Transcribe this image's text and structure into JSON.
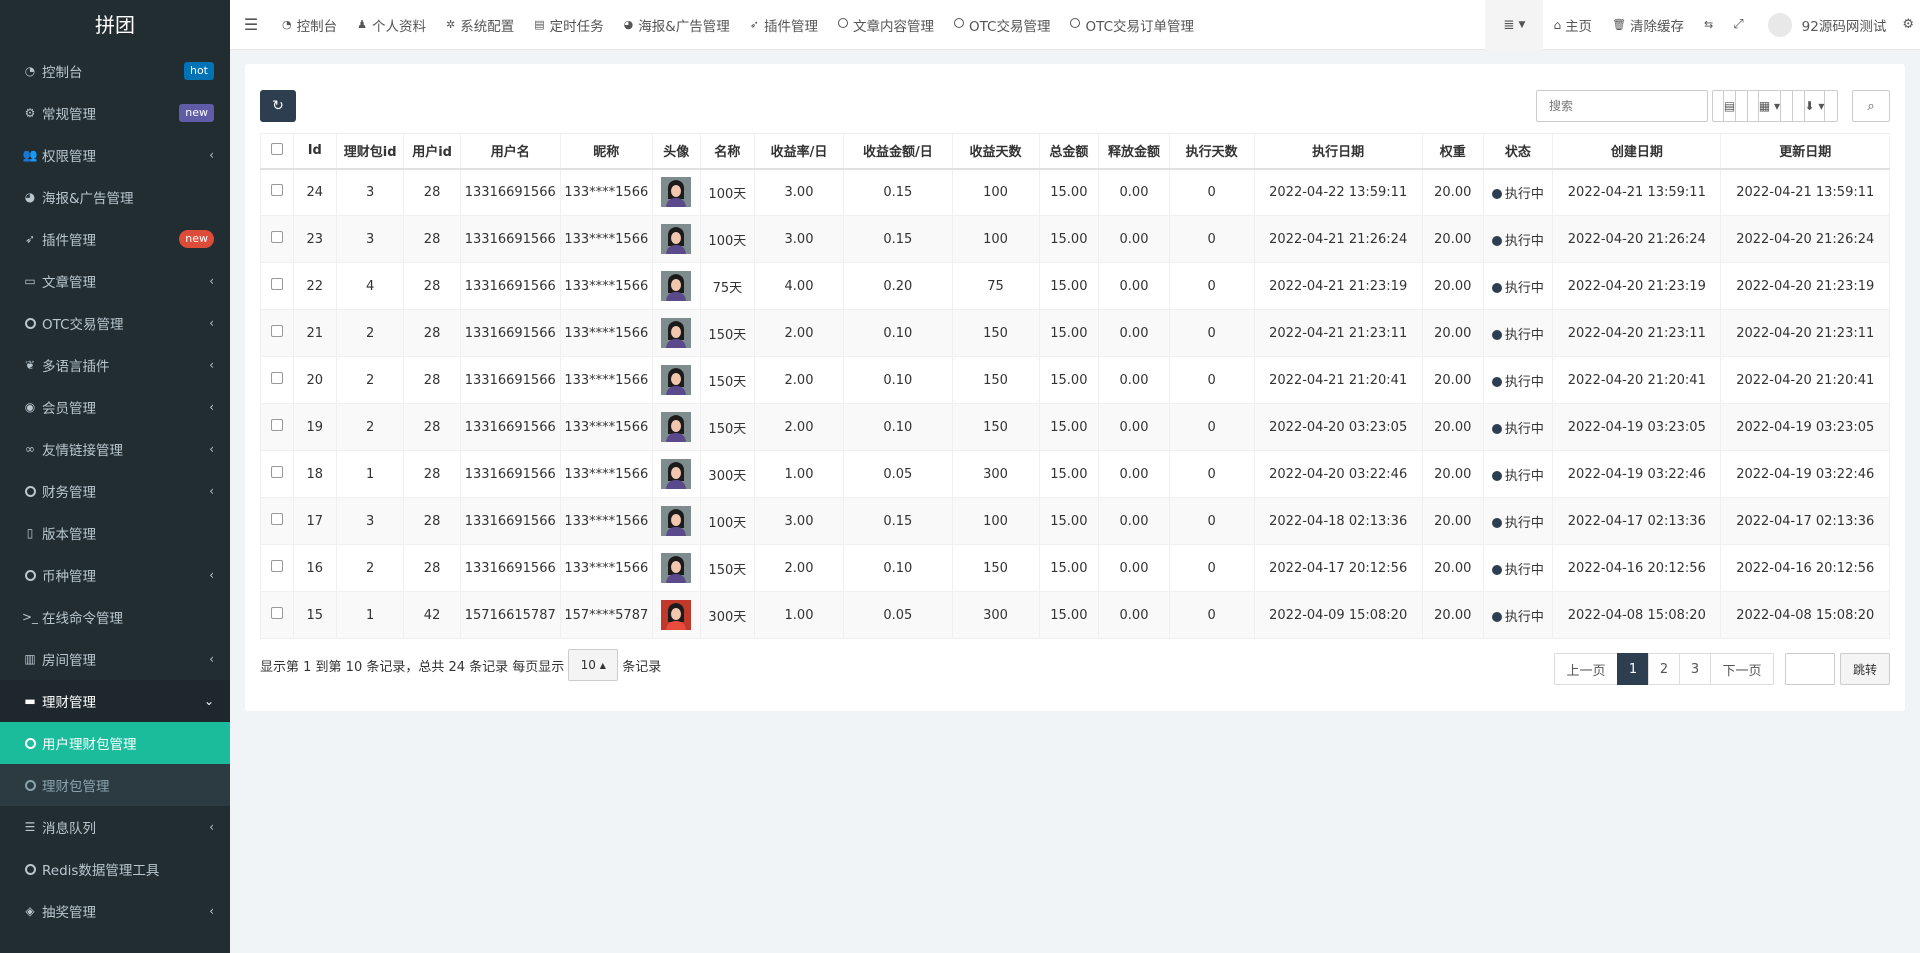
{
  "brand": "拼团",
  "sidebar": {
    "items": [
      {
        "label": "控制台",
        "icon": "dashboard-icon",
        "badge": "hot"
      },
      {
        "label": "常规管理",
        "icon": "cogs-icon",
        "badge": "new"
      },
      {
        "label": "权限管理",
        "icon": "group-icon",
        "arrow": "‹"
      },
      {
        "label": "海报&广告管理",
        "icon": "palette-icon"
      },
      {
        "label": "插件管理",
        "icon": "rocket-icon",
        "badge": "new"
      },
      {
        "label": "文章管理",
        "icon": "folder-icon",
        "arrow": "‹"
      },
      {
        "label": "OTC交易管理",
        "icon": "circle-icon",
        "arrow": "‹"
      },
      {
        "label": "多语言插件",
        "icon": "leaf-icon",
        "arrow": "‹"
      },
      {
        "label": "会员管理",
        "icon": "user-circle-icon",
        "arrow": "‹"
      },
      {
        "label": "友情链接管理",
        "icon": "link-icon",
        "arrow": "‹"
      },
      {
        "label": "财务管理",
        "icon": "circle-icon",
        "arrow": "‹"
      },
      {
        "label": "版本管理",
        "icon": "file-icon"
      },
      {
        "label": "币种管理",
        "icon": "circle-icon",
        "arrow": "‹"
      },
      {
        "label": "在线命令管理",
        "icon": "terminal-icon"
      },
      {
        "label": "房间管理",
        "icon": "bar-chart-icon",
        "arrow": "‹"
      },
      {
        "label": "理财管理",
        "icon": "visa-icon",
        "arrow": "⌄"
      },
      {
        "label": "用户理财包管理",
        "icon": "circle-icon"
      },
      {
        "label": "理财包管理",
        "icon": "circle-icon"
      },
      {
        "label": "消息队列",
        "icon": "list-icon",
        "arrow": "‹"
      },
      {
        "label": "Redis数据管理工具",
        "icon": "circle-icon"
      },
      {
        "label": "抽奖管理",
        "icon": "cube-icon",
        "arrow": "‹"
      }
    ]
  },
  "header": {
    "nav": [
      {
        "label": "控制台",
        "icon": "dashboard-icon"
      },
      {
        "label": "个人资料",
        "icon": "user-icon"
      },
      {
        "label": "系统配置",
        "icon": "gear-icon"
      },
      {
        "label": "定时任务",
        "icon": "tasks-icon"
      },
      {
        "label": "海报&广告管理",
        "icon": "palette-icon"
      },
      {
        "label": "插件管理",
        "icon": "rocket-icon"
      },
      {
        "label": "文章内容管理",
        "icon": "circle-icon"
      },
      {
        "label": "OTC交易管理",
        "icon": "circle-icon"
      },
      {
        "label": "OTC交易订单管理",
        "icon": "circle-icon"
      }
    ],
    "home": "主页",
    "clear_cache": "清除缓存",
    "user": "92源码网测试"
  },
  "toolbar": {
    "search_placeholder": "搜索"
  },
  "table": {
    "columns": [
      "Id",
      "理财包id",
      "用户id",
      "用户名",
      "昵称",
      "头像",
      "名称",
      "收益率/日",
      "收益金额/日",
      "收益天数",
      "总金额",
      "释放金额",
      "执行天数",
      "执行日期",
      "权重",
      "状态",
      "创建日期",
      "更新日期"
    ],
    "rows": [
      [
        "24",
        "3",
        "28",
        "13316691566",
        "133****1566",
        "",
        "100天",
        "3.00",
        "0.15",
        "100",
        "15.00",
        "0.00",
        "0",
        "2022-04-22 13:59:11",
        "20.00",
        "执行中",
        "2022-04-21 13:59:11",
        "2022-04-21 13:59:11"
      ],
      [
        "23",
        "3",
        "28",
        "13316691566",
        "133****1566",
        "",
        "100天",
        "3.00",
        "0.15",
        "100",
        "15.00",
        "0.00",
        "0",
        "2022-04-21 21:26:24",
        "20.00",
        "执行中",
        "2022-04-20 21:26:24",
        "2022-04-20 21:26:24"
      ],
      [
        "22",
        "4",
        "28",
        "13316691566",
        "133****1566",
        "",
        "75天",
        "4.00",
        "0.20",
        "75",
        "15.00",
        "0.00",
        "0",
        "2022-04-21 21:23:19",
        "20.00",
        "执行中",
        "2022-04-20 21:23:19",
        "2022-04-20 21:23:19"
      ],
      [
        "21",
        "2",
        "28",
        "13316691566",
        "133****1566",
        "",
        "150天",
        "2.00",
        "0.10",
        "150",
        "15.00",
        "0.00",
        "0",
        "2022-04-21 21:23:11",
        "20.00",
        "执行中",
        "2022-04-20 21:23:11",
        "2022-04-20 21:23:11"
      ],
      [
        "20",
        "2",
        "28",
        "13316691566",
        "133****1566",
        "",
        "150天",
        "2.00",
        "0.10",
        "150",
        "15.00",
        "0.00",
        "0",
        "2022-04-21 21:20:41",
        "20.00",
        "执行中",
        "2022-04-20 21:20:41",
        "2022-04-20 21:20:41"
      ],
      [
        "19",
        "2",
        "28",
        "13316691566",
        "133****1566",
        "",
        "150天",
        "2.00",
        "0.10",
        "150",
        "15.00",
        "0.00",
        "0",
        "2022-04-20 03:23:05",
        "20.00",
        "执行中",
        "2022-04-19 03:23:05",
        "2022-04-19 03:23:05"
      ],
      [
        "18",
        "1",
        "28",
        "13316691566",
        "133****1566",
        "",
        "300天",
        "1.00",
        "0.05",
        "300",
        "15.00",
        "0.00",
        "0",
        "2022-04-20 03:22:46",
        "20.00",
        "执行中",
        "2022-04-19 03:22:46",
        "2022-04-19 03:22:46"
      ],
      [
        "17",
        "3",
        "28",
        "13316691566",
        "133****1566",
        "",
        "100天",
        "3.00",
        "0.15",
        "100",
        "15.00",
        "0.00",
        "0",
        "2022-04-18 02:13:36",
        "20.00",
        "执行中",
        "2022-04-17 02:13:36",
        "2022-04-17 02:13:36"
      ],
      [
        "16",
        "2",
        "28",
        "13316691566",
        "133****1566",
        "",
        "150天",
        "2.00",
        "0.10",
        "150",
        "15.00",
        "0.00",
        "0",
        "2022-04-17 20:12:56",
        "20.00",
        "执行中",
        "2022-04-16 20:12:56",
        "2022-04-16 20:12:56"
      ],
      [
        "15",
        "1",
        "42",
        "15716615787",
        "157****5787",
        "",
        "300天",
        "1.00",
        "0.05",
        "300",
        "15.00",
        "0.00",
        "0",
        "2022-04-09 15:08:20",
        "20.00",
        "执行中",
        "2022-04-08 15:08:20",
        "2022-04-08 15:08:20"
      ]
    ]
  },
  "footer": {
    "info_prefix": "显示第 1 到第 10 条记录，总共 24 条记录 每页显示",
    "page_size": "10",
    "info_suffix": "条记录",
    "prev": "上一页",
    "pages": [
      "1",
      "2",
      "3"
    ],
    "next": "下一页",
    "jump": "跳转"
  },
  "colors": {
    "sidebar_bg": "#222d32",
    "active_item": "#1abc9c",
    "primary": "#2c3e50"
  }
}
